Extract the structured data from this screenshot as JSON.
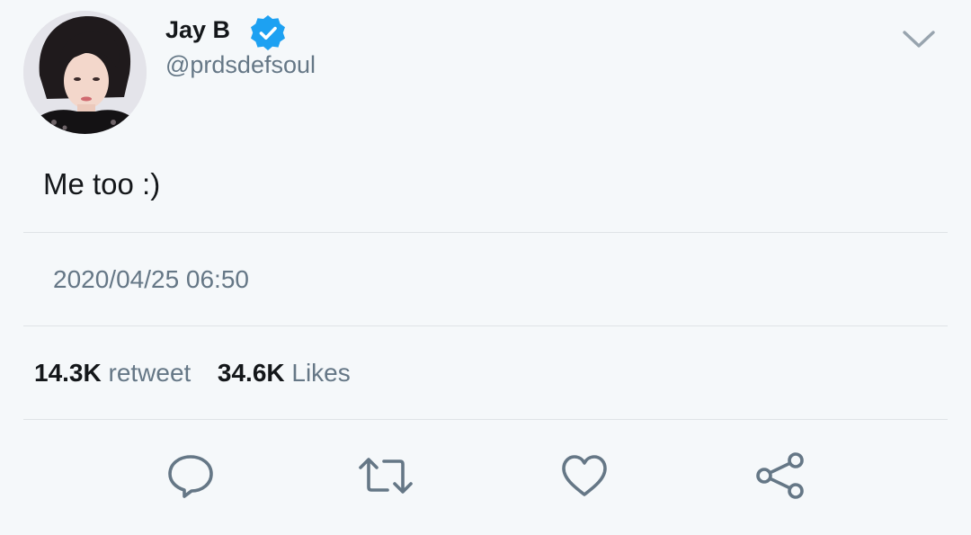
{
  "user": {
    "display_name": "Jay B",
    "handle": "@prdsdefsoul",
    "verified": true
  },
  "tweet": {
    "text": "Me too :)",
    "timestamp": "2020/04/25 06:50"
  },
  "stats": {
    "retweet_count": "14.3K",
    "retweet_label": "retweet",
    "likes_count": "34.6K",
    "likes_label": "Likes"
  },
  "actions": [
    "reply-icon",
    "retweet-icon",
    "like-icon",
    "share-icon"
  ],
  "colors": {
    "background": "#f5f8fa",
    "text_primary": "#14171a",
    "text_secondary": "#657786",
    "verified_blue": "#1da1f2",
    "divider": "#dfe3e7"
  }
}
